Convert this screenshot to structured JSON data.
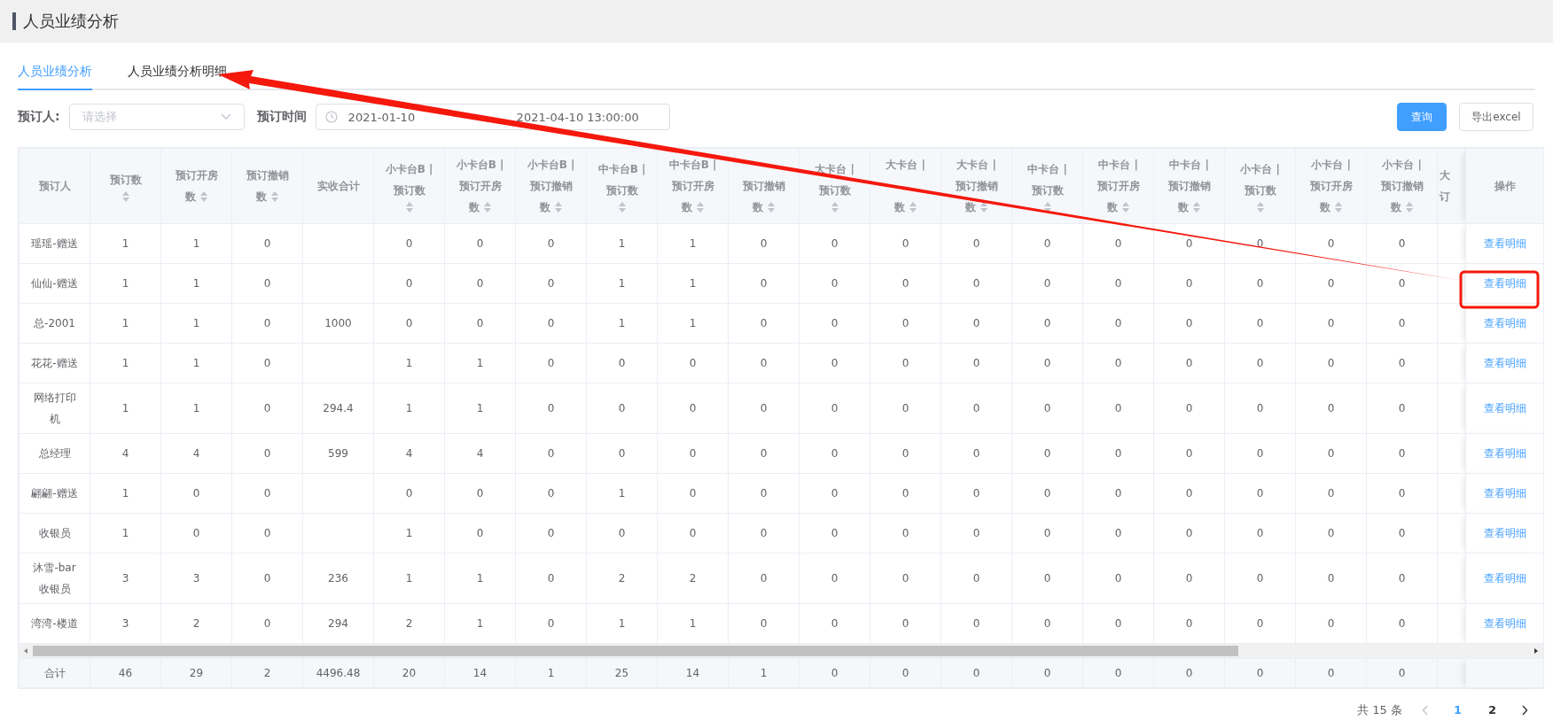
{
  "page_title": "人员业绩分析",
  "tabs": [
    {
      "label": "人员业绩分析",
      "selected": true
    },
    {
      "label": "人员业绩分析明细",
      "selected": false
    }
  ],
  "filters": {
    "booker_label": "预订人:",
    "booker_placeholder": "请选择",
    "time_label": "预订时间",
    "start": "2021-01-10",
    "end": "2021-04-10 13:00:00"
  },
  "buttons": [
    {
      "label": "查询",
      "kind": "primary"
    },
    {
      "label": "导出excel",
      "kind": "plain"
    }
  ],
  "table": {
    "columns": [
      {
        "lines": [
          "预订人"
        ],
        "sortable": false
      },
      {
        "lines": [
          "预订数"
        ],
        "sortable": true
      },
      {
        "lines": [
          "预订开房",
          "数"
        ],
        "sortable": true
      },
      {
        "lines": [
          "预订撤销",
          "数"
        ],
        "sortable": true
      },
      {
        "lines": [
          "实收合计"
        ],
        "sortable": false
      },
      {
        "lines": [
          "小卡台B |",
          "预订数"
        ],
        "sortable": true
      },
      {
        "lines": [
          "小卡台B |",
          "预订开房",
          "数"
        ],
        "sortable": true
      },
      {
        "lines": [
          "小卡台B |",
          "预订撤销",
          "数"
        ],
        "sortable": true
      },
      {
        "lines": [
          "中卡台B |",
          "预订数"
        ],
        "sortable": true
      },
      {
        "lines": [
          "中卡台B |",
          "预订开房",
          "数"
        ],
        "sortable": true
      },
      {
        "lines": [
          {
            "covered": true
          },
          "预订撤销",
          "数"
        ],
        "sortable": true
      },
      {
        "lines": [
          "大卡台 |",
          "预订数"
        ],
        "sortable": true
      },
      {
        "lines": [
          "大卡台 |",
          {
            "covered": true
          },
          "数"
        ],
        "sortable": true
      },
      {
        "lines": [
          "大卡台 |",
          "预订撤销",
          "数"
        ],
        "sortable": true
      },
      {
        "lines": [
          "中卡台 |",
          "预订数"
        ],
        "sortable": true
      },
      {
        "lines": [
          "中卡台 |",
          "预订开房",
          "数"
        ],
        "sortable": true
      },
      {
        "lines": [
          "中卡台 |",
          "预订撤销",
          "数"
        ],
        "sortable": true
      },
      {
        "lines": [
          "小卡台 |",
          "预订数"
        ],
        "sortable": true
      },
      {
        "lines": [
          "小卡台 |",
          "预订开房",
          "数"
        ],
        "sortable": true
      },
      {
        "lines": [
          "小卡台 |",
          "预订撤销",
          "数"
        ],
        "sortable": true
      },
      {
        "lines": [
          "大",
          "订"
        ],
        "sortable": false
      }
    ],
    "action_header": "操作",
    "rows": [
      {
        "cells": [
          "瑶瑶-赠送",
          "1",
          "1",
          "0",
          "",
          "0",
          "0",
          "0",
          "1",
          "1",
          "0",
          "0",
          "0",
          "0",
          "0",
          "0",
          "0",
          "0",
          "0",
          "0"
        ],
        "action": "查看明细"
      },
      {
        "cells": [
          "仙仙-赠送",
          "1",
          "1",
          "0",
          "",
          "0",
          "0",
          "0",
          "1",
          "1",
          "0",
          "0",
          "0",
          "0",
          "0",
          "0",
          "0",
          "0",
          "0",
          "0"
        ],
        "action": "查看明细"
      },
      {
        "cells": [
          "总-2001",
          "1",
          "1",
          "0",
          "1000",
          "0",
          "0",
          "0",
          "1",
          "1",
          "0",
          "0",
          "0",
          "0",
          "0",
          "0",
          "0",
          "0",
          "0",
          "0"
        ],
        "action": "查看明细"
      },
      {
        "cells": [
          "花花-赠送",
          "1",
          "1",
          "0",
          "",
          "1",
          "1",
          "0",
          "0",
          "0",
          "0",
          "0",
          "0",
          "0",
          "0",
          "0",
          "0",
          "0",
          "0",
          "0"
        ],
        "action": "查看明细"
      },
      {
        "cells": [
          "网络打印机",
          "1",
          "1",
          "0",
          "294.4",
          "1",
          "1",
          "0",
          "0",
          "0",
          "0",
          "0",
          "0",
          "0",
          "0",
          "0",
          "0",
          "0",
          "0",
          "0"
        ],
        "action": "查看明细"
      },
      {
        "cells": [
          "总经理",
          "4",
          "4",
          "0",
          "599",
          "4",
          "4",
          "0",
          "0",
          "0",
          "0",
          "0",
          "0",
          "0",
          "0",
          "0",
          "0",
          "0",
          "0",
          "0"
        ],
        "action": "查看明细"
      },
      {
        "cells": [
          "翩翩-赠送",
          "1",
          "0",
          "0",
          "",
          "0",
          "0",
          "0",
          "1",
          "0",
          "0",
          "0",
          "0",
          "0",
          "0",
          "0",
          "0",
          "0",
          "0",
          "0"
        ],
        "action": "查看明细"
      },
      {
        "cells": [
          "收银员",
          "1",
          "0",
          "0",
          "",
          "1",
          "0",
          "0",
          "0",
          "0",
          "0",
          "0",
          "0",
          "0",
          "0",
          "0",
          "0",
          "0",
          "0",
          "0"
        ],
        "action": "查看明细"
      },
      {
        "cells": [
          "沐雪-bar收银员",
          "3",
          "3",
          "0",
          "236",
          "1",
          "1",
          "0",
          "2",
          "2",
          "0",
          "0",
          "0",
          "0",
          "0",
          "0",
          "0",
          "0",
          "0",
          "0"
        ],
        "action": "查看明细"
      },
      {
        "cells": [
          "湾湾-楼道",
          "3",
          "2",
          "0",
          "294",
          "2",
          "1",
          "0",
          "1",
          "1",
          "0",
          "0",
          "0",
          "0",
          "0",
          "0",
          "0",
          "0",
          "0",
          "0"
        ],
        "action": "查看明细"
      }
    ],
    "totals": [
      "合计",
      "46",
      "29",
      "2",
      "4496.48",
      "20",
      "14",
      "1",
      "25",
      "14",
      "1",
      "0",
      "0",
      "0",
      "0",
      "0",
      "0",
      "0",
      "0",
      "0"
    ]
  },
  "pagination": {
    "total": "共 15 条",
    "prev_disabled": true,
    "pages": [
      {
        "label": "1",
        "selected": true
      },
      {
        "label": "2",
        "selected": false
      }
    ]
  }
}
